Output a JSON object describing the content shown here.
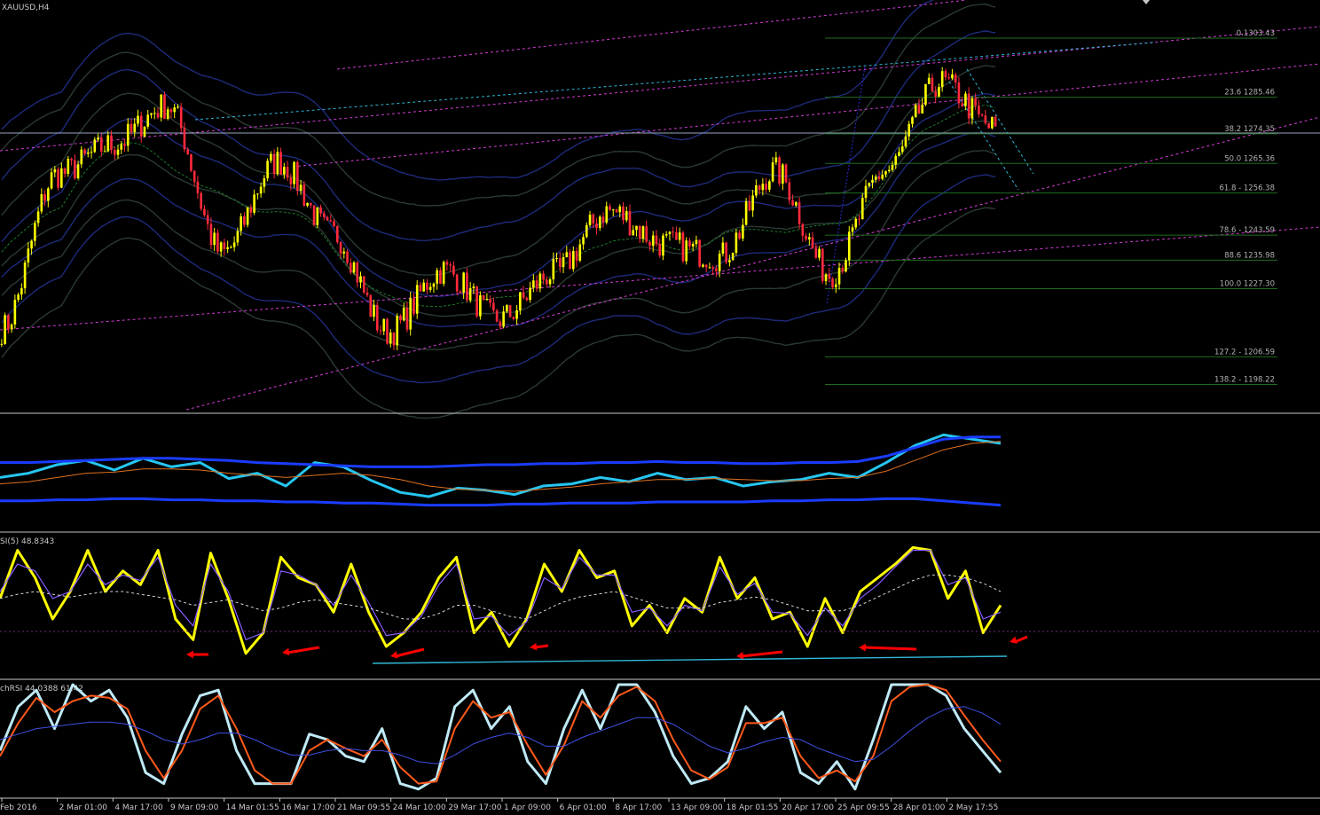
{
  "chart_title": "XAUUSD,H4",
  "colors": {
    "background": "#000000",
    "bull_candle": "#ffff00",
    "bear_candle": "#ff2a3c",
    "channel": "#d33bd3",
    "trendline_cyan": "#2fb7d6",
    "fib_line": "#1f6b1f",
    "band_dark": "#2b3a33",
    "band_navy": "#1e2a7a",
    "rsi_main": "#ffff00",
    "rsi_signal": "#8a5cff",
    "stoch_k": "#bfe9f5",
    "stoch_d": "#ff5a1a",
    "osc_main": "#26c6f0",
    "osc_band": "#1a3cff",
    "arrow": "#ff0000",
    "separator": "#c8c8c8"
  },
  "chart_data": [
    {
      "type": "candlestick",
      "title": "XAUUSD,H4",
      "symbol": "XAUUSD",
      "timeframe": "H4",
      "ylim": [
        1190,
        1315
      ],
      "price_anchors": [
        {
          "label": "Feb 2016",
          "price": 1215
        },
        {
          "label": "2 Mar 01:00",
          "price": 1262
        },
        {
          "label": "4 Mar 17:00",
          "price": 1271
        },
        {
          "label": "9 Mar 09:00",
          "price": 1283
        },
        {
          "label": "14 Mar 01:55",
          "price": 1238
        },
        {
          "label": "16 Mar 17:00",
          "price": 1266
        },
        {
          "label": "21 Mar 09:55",
          "price": 1244
        },
        {
          "label": "24 Mar 10:00",
          "price": 1214
        },
        {
          "label": "29 Mar 17:00",
          "price": 1233
        },
        {
          "label": "1 Apr 09:00",
          "price": 1218
        },
        {
          "label": "6 Apr 01:00",
          "price": 1232
        },
        {
          "label": "8 Apr 17:00",
          "price": 1251
        },
        {
          "label": "13 Apr 09:00",
          "price": 1241
        },
        {
          "label": "18 Apr 01:55",
          "price": 1237
        },
        {
          "label": "20 Apr 17:00",
          "price": 1263
        },
        {
          "label": "25 Apr 09:55",
          "price": 1232
        },
        {
          "label": "28 Apr 01:00",
          "price": 1263
        },
        {
          "label": "2 May 17:55",
          "price": 1290
        },
        {
          "label": "",
          "price": 1276
        }
      ],
      "fib_levels": [
        {
          "label": "0.1303.43",
          "price": 1303.43
        },
        {
          "label": "23.6 1285.46",
          "price": 1285.46
        },
        {
          "label": "38.2 1274.35",
          "price": 1274.35
        },
        {
          "label": "50.0 1265.36",
          "price": 1265.36
        },
        {
          "label": "61.8 - 1256.38",
          "price": 1256.38
        },
        {
          "label": "78.6 - 1243.59",
          "price": 1243.59
        },
        {
          "label": "88.6 1235.98",
          "price": 1235.98
        },
        {
          "label": "100.0 1227.30",
          "price": 1227.3
        },
        {
          "label": "127.2 - 1206.59",
          "price": 1206.59
        },
        {
          "label": "138.2 - 1198.22",
          "price": 1198.22
        }
      ],
      "x_tick_labels": [
        "Feb 2016",
        "2 Mar 01:00",
        "4 Mar 17:00",
        "9 Mar 09:00",
        "14 Mar 01:55",
        "16 Mar 17:00",
        "21 Mar 09:55",
        "24 Mar 10:00",
        "29 Mar 17:00",
        "1 Apr 09:00",
        "6 Apr 01:00",
        "8 Apr 17:00",
        "13 Apr 09:00",
        "18 Apr 01:55",
        "20 Apr 17:00",
        "25 Apr 09:55",
        "28 Apr 01:00",
        "2 May 17:55"
      ]
    },
    {
      "type": "line",
      "title": "",
      "ylim": [
        0,
        100
      ],
      "series": [
        {
          "key": "osc",
          "values": [
            48,
            52,
            60,
            64,
            55,
            66,
            58,
            62,
            47,
            52,
            40,
            62,
            58,
            45,
            34,
            30,
            38,
            36,
            32,
            40,
            42,
            48,
            44,
            52,
            46,
            48,
            40,
            44,
            46,
            52,
            48,
            62,
            78,
            88,
            84,
            80
          ]
        },
        {
          "key": "band_top",
          "values": [
            62,
            62,
            63,
            64,
            65,
            66,
            66,
            65,
            64,
            62,
            61,
            60,
            59,
            58,
            58,
            58,
            59,
            60,
            60,
            61,
            61,
            62,
            62,
            63,
            62,
            62,
            61,
            61,
            62,
            62,
            63,
            68,
            76,
            84,
            86,
            86
          ]
        },
        {
          "key": "band_bottom",
          "values": [
            26,
            26,
            27,
            27,
            28,
            28,
            27,
            27,
            26,
            26,
            25,
            25,
            24,
            24,
            23,
            22,
            22,
            22,
            23,
            23,
            24,
            24,
            24,
            25,
            25,
            25,
            25,
            26,
            26,
            27,
            27,
            28,
            28,
            26,
            24,
            22
          ]
        },
        {
          "key": "signal",
          "values": [
            42,
            44,
            48,
            52,
            53,
            56,
            56,
            55,
            52,
            50,
            48,
            50,
            52,
            50,
            46,
            40,
            37,
            36,
            35,
            37,
            39,
            42,
            44,
            46,
            46,
            47,
            46,
            45,
            45,
            47,
            48,
            54,
            64,
            74,
            80,
            82
          ]
        }
      ]
    },
    {
      "type": "line",
      "title": "",
      "label": "SI(5) 48.8343",
      "ylim": [
        0,
        100
      ],
      "series": [
        {
          "key": "rsi",
          "values": [
            55,
            90,
            70,
            40,
            60,
            90,
            60,
            75,
            65,
            90,
            40,
            25,
            88,
            55,
            15,
            30,
            85,
            70,
            65,
            45,
            80,
            45,
            20,
            30,
            45,
            70,
            85,
            30,
            45,
            20,
            40,
            80,
            60,
            90,
            70,
            75,
            35,
            50,
            30,
            55,
            45,
            85,
            55,
            70,
            40,
            45,
            20,
            55,
            30,
            60,
            70,
            80,
            92,
            90,
            55,
            75,
            30,
            50
          ]
        },
        {
          "key": "rsi_signal",
          "values": [
            60,
            80,
            75,
            55,
            60,
            80,
            65,
            72,
            68,
            85,
            50,
            35,
            80,
            60,
            25,
            30,
            75,
            72,
            65,
            50,
            72,
            52,
            28,
            30,
            42,
            65,
            80,
            40,
            42,
            28,
            38,
            70,
            62,
            85,
            72,
            72,
            45,
            48,
            35,
            50,
            46,
            78,
            58,
            66,
            45,
            44,
            28,
            48,
            35,
            55,
            65,
            78,
            90,
            90,
            65,
            70,
            40,
            45
          ]
        },
        {
          "key": "rsi_ma",
          "values": [
            55,
            58,
            60,
            58,
            56,
            58,
            60,
            60,
            58,
            56,
            54,
            50,
            52,
            54,
            50,
            46,
            48,
            52,
            54,
            52,
            50,
            48,
            44,
            40,
            40,
            44,
            50,
            50,
            46,
            42,
            40,
            46,
            52,
            56,
            58,
            60,
            56,
            52,
            48,
            48,
            48,
            52,
            54,
            56,
            54,
            50,
            46,
            46,
            46,
            50,
            56,
            62,
            68,
            72,
            72,
            70,
            66,
            60
          ]
        }
      ]
    },
    {
      "type": "line",
      "title": "",
      "label": "chRSI 44.0388 61.42",
      "ylim": [
        0,
        100
      ],
      "series": [
        {
          "key": "stoch_k",
          "values": [
            40,
            80,
            95,
            60,
            100,
            85,
            95,
            70,
            20,
            10,
            55,
            90,
            95,
            40,
            10,
            10,
            10,
            55,
            50,
            35,
            30,
            60,
            10,
            5,
            15,
            80,
            95,
            60,
            80,
            30,
            10,
            60,
            95,
            60,
            100,
            100,
            75,
            35,
            10,
            15,
            30,
            80,
            60,
            75,
            20,
            10,
            30,
            5,
            50,
            100,
            100,
            100,
            90,
            60,
            40,
            20
          ]
        },
        {
          "key": "stoch_d",
          "values": [
            35,
            65,
            88,
            75,
            85,
            90,
            88,
            78,
            40,
            15,
            40,
            78,
            90,
            60,
            22,
            10,
            10,
            40,
            50,
            42,
            35,
            50,
            25,
            10,
            12,
            60,
            85,
            70,
            75,
            45,
            18,
            45,
            85,
            70,
            90,
            98,
            85,
            50,
            22,
            14,
            25,
            65,
            65,
            70,
            35,
            15,
            22,
            12,
            35,
            85,
            98,
            100,
            95,
            72,
            50,
            30
          ]
        },
        {
          "key": "stoch_ma",
          "values": [
            50,
            55,
            60,
            62,
            64,
            66,
            66,
            64,
            58,
            50,
            46,
            50,
            56,
            56,
            50,
            42,
            36,
            36,
            40,
            42,
            40,
            40,
            36,
            30,
            28,
            36,
            46,
            52,
            56,
            52,
            44,
            44,
            52,
            58,
            64,
            70,
            70,
            64,
            54,
            44,
            38,
            42,
            48,
            52,
            50,
            42,
            36,
            30,
            32,
            44,
            58,
            70,
            78,
            80,
            74,
            64
          ]
        }
      ]
    }
  ]
}
